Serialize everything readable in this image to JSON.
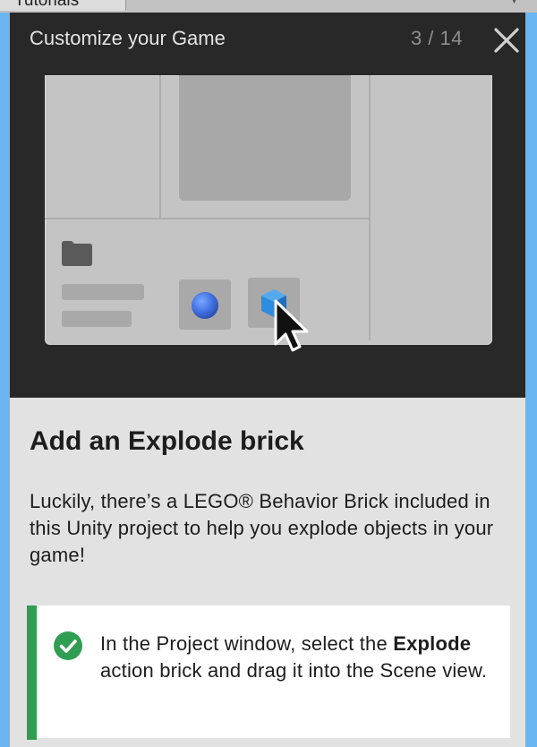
{
  "window_tab": {
    "label": "Tutorials"
  },
  "header": {
    "title": "Customize your Game",
    "counter": "3 / 14"
  },
  "step": {
    "heading": "Add an Explode brick",
    "body": "Luckily, there’s a LEGO® Behavior Brick included in this Unity project to help you explode objects in your game!"
  },
  "task": {
    "text_before": "In the Project window, select the ",
    "bold": "Explode",
    "text_after": " action brick and drag it into the Scene view.",
    "status": "completed"
  },
  "colors": {
    "header_bg": "#282828",
    "panel_bg": "#e2e2e2",
    "accent_green": "#2f9e52",
    "outer_frame": "#6bb5f0",
    "sphere_blue": "#3f6fe0",
    "cube_blue": "#2d8de0"
  },
  "icons": [
    "close-icon",
    "check-circle-icon",
    "folder-icon",
    "cursor-arrow-icon",
    "sphere-asset-icon",
    "cube-asset-icon"
  ]
}
